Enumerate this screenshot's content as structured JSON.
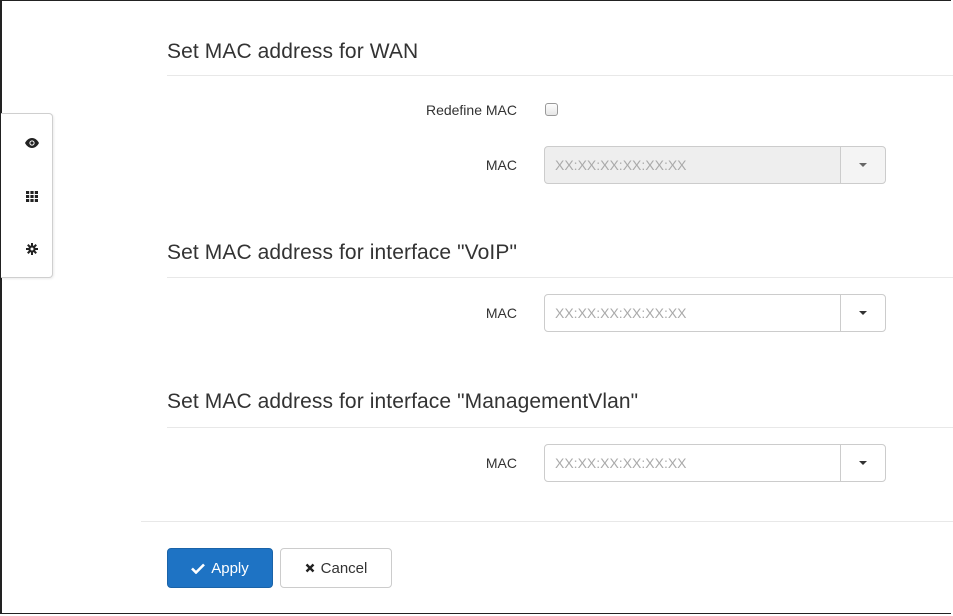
{
  "sections": [
    {
      "title": "Set MAC address for WAN",
      "redefine_label": "Redefine MAC",
      "redefine_checked": false,
      "mac_label": "MAC",
      "mac_placeholder": "XX:XX:XX:XX:XX:XX",
      "mac_disabled": true
    },
    {
      "title": "Set MAC address for interface \"VoIP\"",
      "mac_label": "MAC",
      "mac_placeholder": "XX:XX:XX:XX:XX:XX"
    },
    {
      "title": "Set MAC address for interface \"ManagementVlan\"",
      "mac_label": "MAC",
      "mac_placeholder": "XX:XX:XX:XX:XX:XX"
    }
  ],
  "side_panel": {
    "icons": [
      "eye-icon",
      "grid-icon",
      "gear-icon"
    ]
  },
  "actions": {
    "apply_label": "Apply",
    "cancel_label": "Cancel"
  },
  "colors": {
    "apply_bg": "#1e73c4",
    "disabled_input_bg": "#eeeeee"
  }
}
